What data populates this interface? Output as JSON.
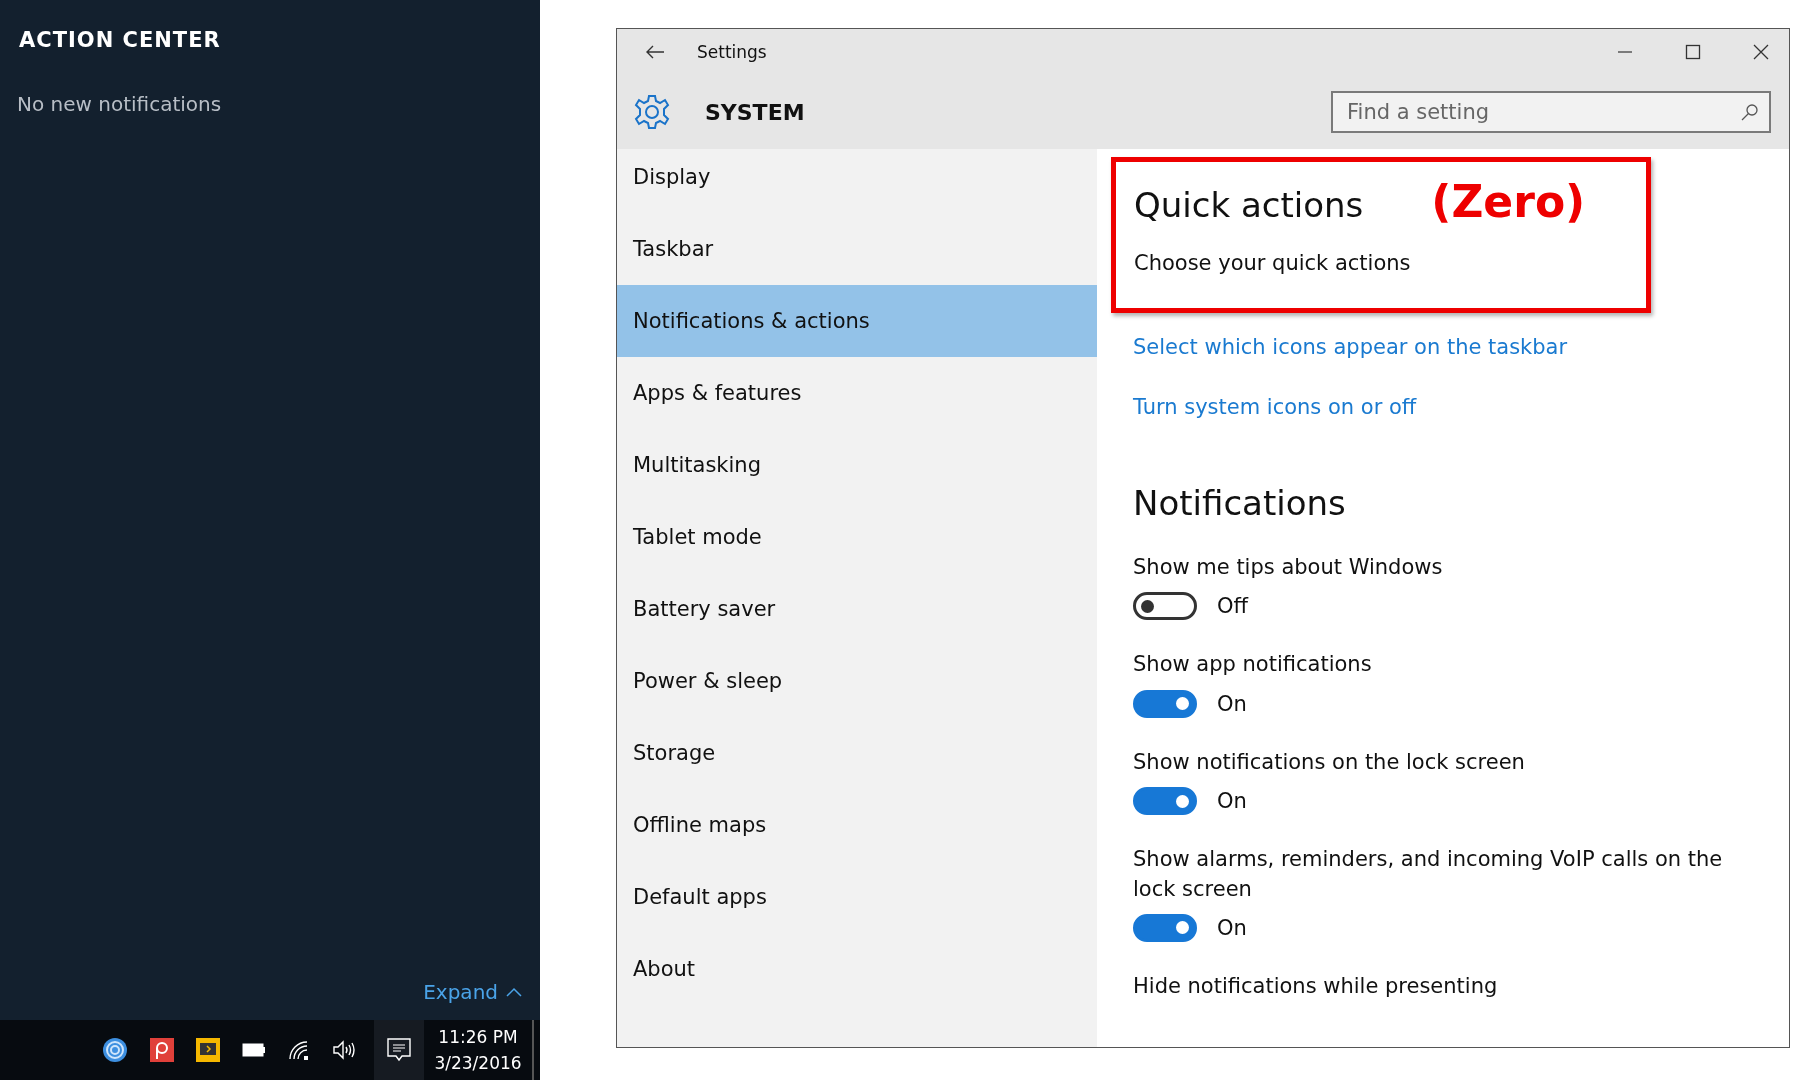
{
  "action_center": {
    "title": "ACTION CENTER",
    "message": "No new notifications",
    "expand": "Expand"
  },
  "taskbar": {
    "time": "11:26 PM",
    "date": "3/23/2016"
  },
  "window": {
    "title": "Settings",
    "section": "SYSTEM",
    "search": {
      "placeholder": "Find a setting"
    }
  },
  "sidebar": {
    "items": [
      {
        "label": "Display",
        "selected": false
      },
      {
        "label": "Taskbar",
        "selected": false
      },
      {
        "label": "Notifications & actions",
        "selected": true
      },
      {
        "label": "Apps & features",
        "selected": false
      },
      {
        "label": "Multitasking",
        "selected": false
      },
      {
        "label": "Tablet mode",
        "selected": false
      },
      {
        "label": "Battery saver",
        "selected": false
      },
      {
        "label": "Power & sleep",
        "selected": false
      },
      {
        "label": "Storage",
        "selected": false
      },
      {
        "label": "Offline maps",
        "selected": false
      },
      {
        "label": "Default apps",
        "selected": false
      },
      {
        "label": "About",
        "selected": false
      }
    ]
  },
  "content": {
    "heading": "Quick actions",
    "annotation": "(Zero)",
    "subtitle": "Choose your quick actions",
    "links": [
      "Select which icons appear on the taskbar",
      "Turn system icons on or off"
    ],
    "notifications_heading": "Notifications",
    "settings": [
      {
        "kind": "toggle",
        "label": "Show me tips about Windows",
        "on": false,
        "state": "Off"
      },
      {
        "kind": "toggle",
        "label": "Show app notifications",
        "on": true,
        "state": "On"
      },
      {
        "kind": "toggle",
        "label": "Show notifications on the lock screen",
        "on": true,
        "state": "On"
      },
      {
        "kind": "toggle",
        "label": "Show alarms, reminders, and incoming VoIP calls on the lock screen",
        "on": true,
        "state": "On"
      },
      {
        "kind": "label",
        "label": "Hide notifications while presenting"
      }
    ]
  }
}
